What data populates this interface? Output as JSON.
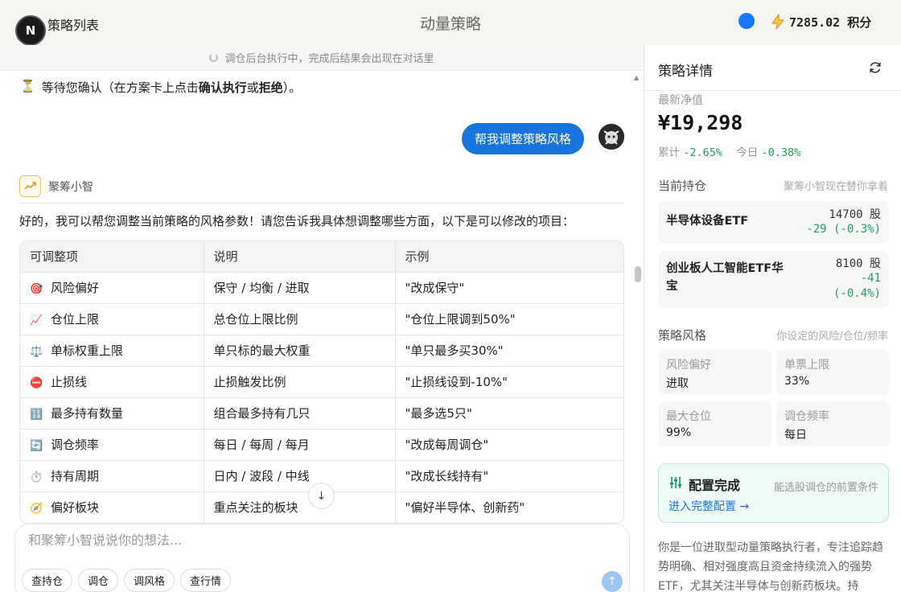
{
  "header": {
    "logo_letter": "N",
    "back_label": "策略列表",
    "title": "动量策略",
    "points": "7285.02 积分"
  },
  "chat": {
    "banner": "调仓后台执行中，完成后结果会出现在对话里",
    "waiting": {
      "icon": "⏳",
      "prefix": "等待您确认（在方案卡上点击",
      "confirm": "确认执行",
      "middle": "或",
      "reject": "拒绝",
      "suffix": "）。"
    },
    "user_message": "帮我调整策略风格",
    "bot_name": "聚筹小智",
    "bot_intro": "好的，我可以帮您调整当前策略的风格参数！请您告诉我具体想调整哪些方面，以下是可以修改的项目：",
    "table": {
      "headers": [
        "可调整项",
        "说明",
        "示例"
      ],
      "rows": [
        {
          "icon": "🎯",
          "item": "风险偏好",
          "desc": "保守 / 均衡 / 进取",
          "example": "\"改成保守\""
        },
        {
          "icon": "📈",
          "item": "仓位上限",
          "desc": "总仓位上限比例",
          "example": "\"仓位上限调到50%\""
        },
        {
          "icon": "⚖️",
          "item": "单标权重上限",
          "desc": "单只标的最大权重",
          "example": "\"单只最多买30%\""
        },
        {
          "icon": "⛔",
          "item": "止损线",
          "desc": "止损触发比例",
          "example": "\"止损线设到-10%\""
        },
        {
          "icon": "🔢",
          "item": "最多持有数量",
          "desc": "组合最多持有几只",
          "example": "\"最多选5只\""
        },
        {
          "icon": "🔄",
          "item": "调仓频率",
          "desc": "每日 / 每周 / 每月",
          "example": "\"改成每周调仓\""
        },
        {
          "icon": "⏱️",
          "item": "持有周期",
          "desc": "日内 / 波段 / 中线",
          "example": "\"改成长线持有\""
        },
        {
          "icon": "🧭",
          "item": "偏好板块",
          "desc": "重点关注的板块",
          "example": "\"偏好半导体、创新药\""
        }
      ]
    },
    "composer": {
      "placeholder": "和聚筹小智说说你的想法...",
      "chips": [
        "查持仓",
        "调仓",
        "调风格",
        "查行情"
      ]
    }
  },
  "panel": {
    "title": "策略详情",
    "nav_label": "最新净值",
    "nav_value": "¥19,298",
    "cumulative_label": "累计",
    "cumulative_value": "-2.65%",
    "today_label": "今日",
    "today_value": "-0.38%",
    "holdings_title": "当前持仓",
    "holdings_sub": "聚筹小智现在替你拿着",
    "holdings": [
      {
        "name": "半导体设备ETF",
        "qty": "14700 股",
        "change": "-29 (-0.3%)"
      },
      {
        "name_line1": "创业板人工智能ETF华",
        "name_line2": "宝",
        "qty": "8100 股",
        "change_line1": "-41",
        "change_line2": "(-0.4%)"
      }
    ],
    "style_title": "策略风格",
    "style_sub": "你设定的风险/仓位/频率",
    "style_items": [
      {
        "label": "风险偏好",
        "value": "进取"
      },
      {
        "label": "单票上限",
        "value": "33%"
      },
      {
        "label": "最大仓位",
        "value": "99%"
      },
      {
        "label": "调仓频率",
        "value": "每日"
      }
    ],
    "config": {
      "title": "配置完成",
      "sub": "能选股调仓的前置条件",
      "link": "进入完整配置 →"
    },
    "description": "你是一位进取型动量策略执行者，专注追踪趋势明确、相对强度高且资金持续流入的强势ETF，尤其关注半导体与创新药板块。持"
  },
  "colors": {
    "accent": "#1873dd",
    "positive_green": "#1aa05a",
    "status_dot": "#1677ff"
  }
}
